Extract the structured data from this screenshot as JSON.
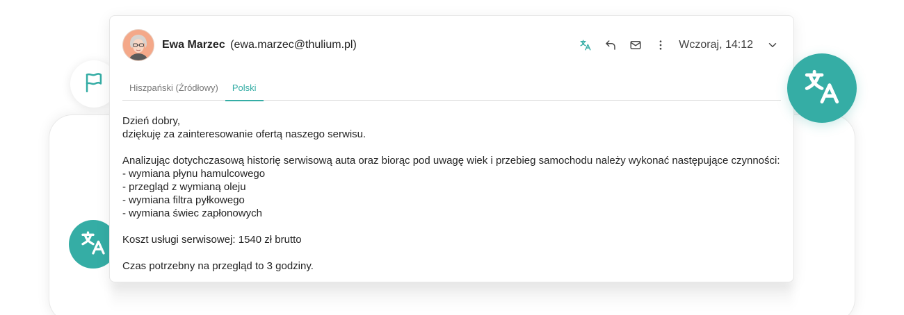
{
  "email": {
    "sender_name": "Ewa Marzec",
    "sender_email": "(ewa.marzec@thulium.pl)",
    "datetime": "Wczoraj, 14:12"
  },
  "icons": {
    "translate": "translate-icon",
    "reply": "reply-icon",
    "mail": "mail-icon",
    "more": "more-vertical-icon",
    "expand": "chevron-down-icon",
    "flag": "flag-icon"
  },
  "tabs": [
    {
      "label": "Hiszpański (Źródłowy)",
      "active": false
    },
    {
      "label": "Polski",
      "active": true
    }
  ],
  "message": {
    "greeting": "Dzień dobry,",
    "thanks": "dziękuję za zainteresowanie ofertą naszego serwisu.",
    "intro": "Analizując dotychczasową historię serwisową auta oraz biorąc pod uwagę wiek i przebieg samochodu należy wykonać następujące czynności:",
    "items": [
      "- wymiana płynu hamulcowego",
      "- przegląd z wymianą oleju",
      "- wymiana filtra pyłkowego",
      "- wymiana świec zapłonowych"
    ],
    "cost": "Koszt usługi serwisowej: 1540 zł brutto",
    "time": "Czas potrzebny na przegląd to 3 godziny."
  },
  "colors": {
    "accent": "#35ada5",
    "text": "#222222",
    "muted": "#777777"
  }
}
